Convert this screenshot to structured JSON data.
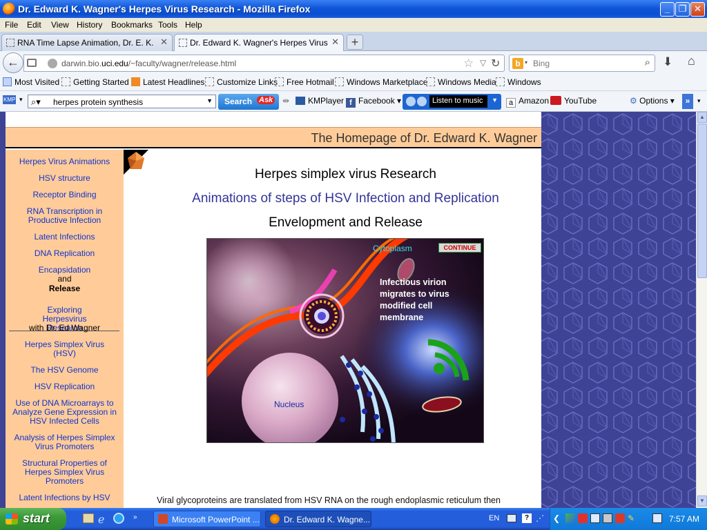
{
  "window": {
    "title": "Dr. Edward K. Wagner's Herpes Virus Research - Mozilla Firefox"
  },
  "menu": [
    "File",
    "Edit",
    "View",
    "History",
    "Bookmarks",
    "Tools",
    "Help"
  ],
  "tabs": [
    {
      "label": "RNA Time Lapse Animation, Dr. E. K. Wa..."
    },
    {
      "label": "Dr. Edward K. Wagner's Herpes Virus Re..."
    }
  ],
  "nav": {
    "url_prefix": "darwin.bio.",
    "url_domain": "uci.edu",
    "url_path": "/~faculty/wagner/release.html",
    "search_placeholder": "Bing"
  },
  "bookmarks": [
    "Most Visited",
    "Getting Started",
    "Latest Headlines",
    "Customize Links",
    "Free Hotmail",
    "Windows Marketplace",
    "Windows Media",
    "Windows"
  ],
  "asktoolbar": {
    "query": "herpes protein synthesis",
    "search_label": "Search",
    "ask_label": "Ask",
    "kmplayer": "KMPlayer",
    "facebook": "Facebook",
    "music": "Listen to music",
    "amazon": "Amazon",
    "youtube": "YouTube",
    "options": "Options"
  },
  "page": {
    "header_title": "The Homepage of Dr. Edward K. Wagner",
    "sidebar": {
      "links": [
        "Herpes Virus Animations",
        "HSV structure",
        "Receptor Binding",
        "RNA Transcription in Productive Infection",
        "Latent Infections",
        "DNA Replication",
        "Encapsidation"
      ],
      "and_text": "and",
      "current": "Release",
      "links2": [
        "Exploring Herpesvirus Research",
        "Herpes Simplex Virus (HSV)",
        "The HSV Genome",
        "HSV Replication",
        "Use of DNA Microarrays to Analyze Gene Expression in HSV Infected Cells",
        "Analysis of Herpes Simplex Virus Promoters",
        "Structural Properties of Herpes Simplex Virus Promoters",
        "Latent Infections by HSV"
      ],
      "with_text": "with Dr. Ed Wagner"
    },
    "heading1": "Herpes simplex virus Research",
    "heading2": "Animations of steps of HSV Infection and Replication",
    "heading3": "Envelopment and Release",
    "animation": {
      "cytoplasm": "Cytoplasm",
      "continue": "CONTINUE",
      "note": "Infectious virion migrates to virus modified cell membrane",
      "nucleus": "Nucleus"
    },
    "description": "Viral glycoproteins are translated from HSV RNA on the rough endoplasmic reticulum then transported to the golgi body in vesicles to continue the glycosylation process. The glycoproteins are then transported in vesicles to the nuclear or plasma membrane."
  },
  "taskbar": {
    "start": "start",
    "tasks": [
      "Microsoft PowerPoint ...",
      "Dr. Edward K. Wagne..."
    ],
    "lang": "EN",
    "clock": "7:57 AM"
  }
}
